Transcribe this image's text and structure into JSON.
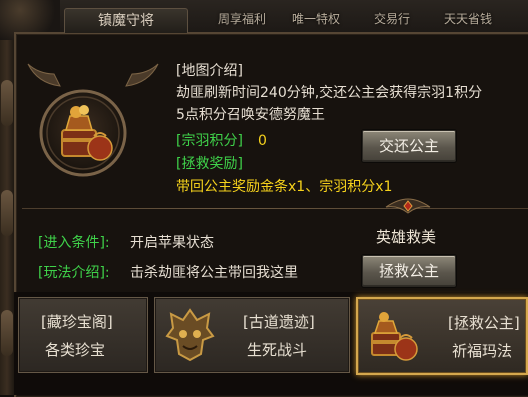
{
  "window": {
    "title": "镇魔守将"
  },
  "top_nav": {
    "items": [
      {
        "label": "周享福利"
      },
      {
        "label": "唯一特权"
      },
      {
        "label": "交易行"
      },
      {
        "label": "天天省钱"
      }
    ]
  },
  "map_info": {
    "heading": "[地图介绍]",
    "desc_line1": "劫匪刷新时间240分钟,交还公主会获得宗羽1积分",
    "desc_line2": "5点积分召唤安德努魔王",
    "points_label": "[宗羽积分]",
    "points_value": "0",
    "reward_label": "[拯救奖励]",
    "reward_text": "带回公主奖励金条x1、宗羽积分x1",
    "return_button": "交还公主"
  },
  "conditions": {
    "entry_label": "[进入条件]:",
    "entry_value": "开启苹果状态",
    "play_label": "[玩法介绍]:",
    "play_value": "击杀劫匪将公主带回我这里",
    "hero_title": "英雄救美",
    "rescue_button": "拯救公主"
  },
  "cards": [
    {
      "tag": "[藏珍宝阁]",
      "subtitle": "各类珍宝",
      "icon": "none"
    },
    {
      "tag": "[古道遗迹]",
      "subtitle": "生死战斗",
      "icon": "demon-mask-icon"
    },
    {
      "tag": "[拯救公主]",
      "subtitle": "祈福玛法",
      "icon": "treasure-bundle-icon",
      "selected": true
    }
  ],
  "colors": {
    "green": "#3fd24a",
    "yellow": "#f6d21c",
    "gold_border": "#d5a84e"
  }
}
